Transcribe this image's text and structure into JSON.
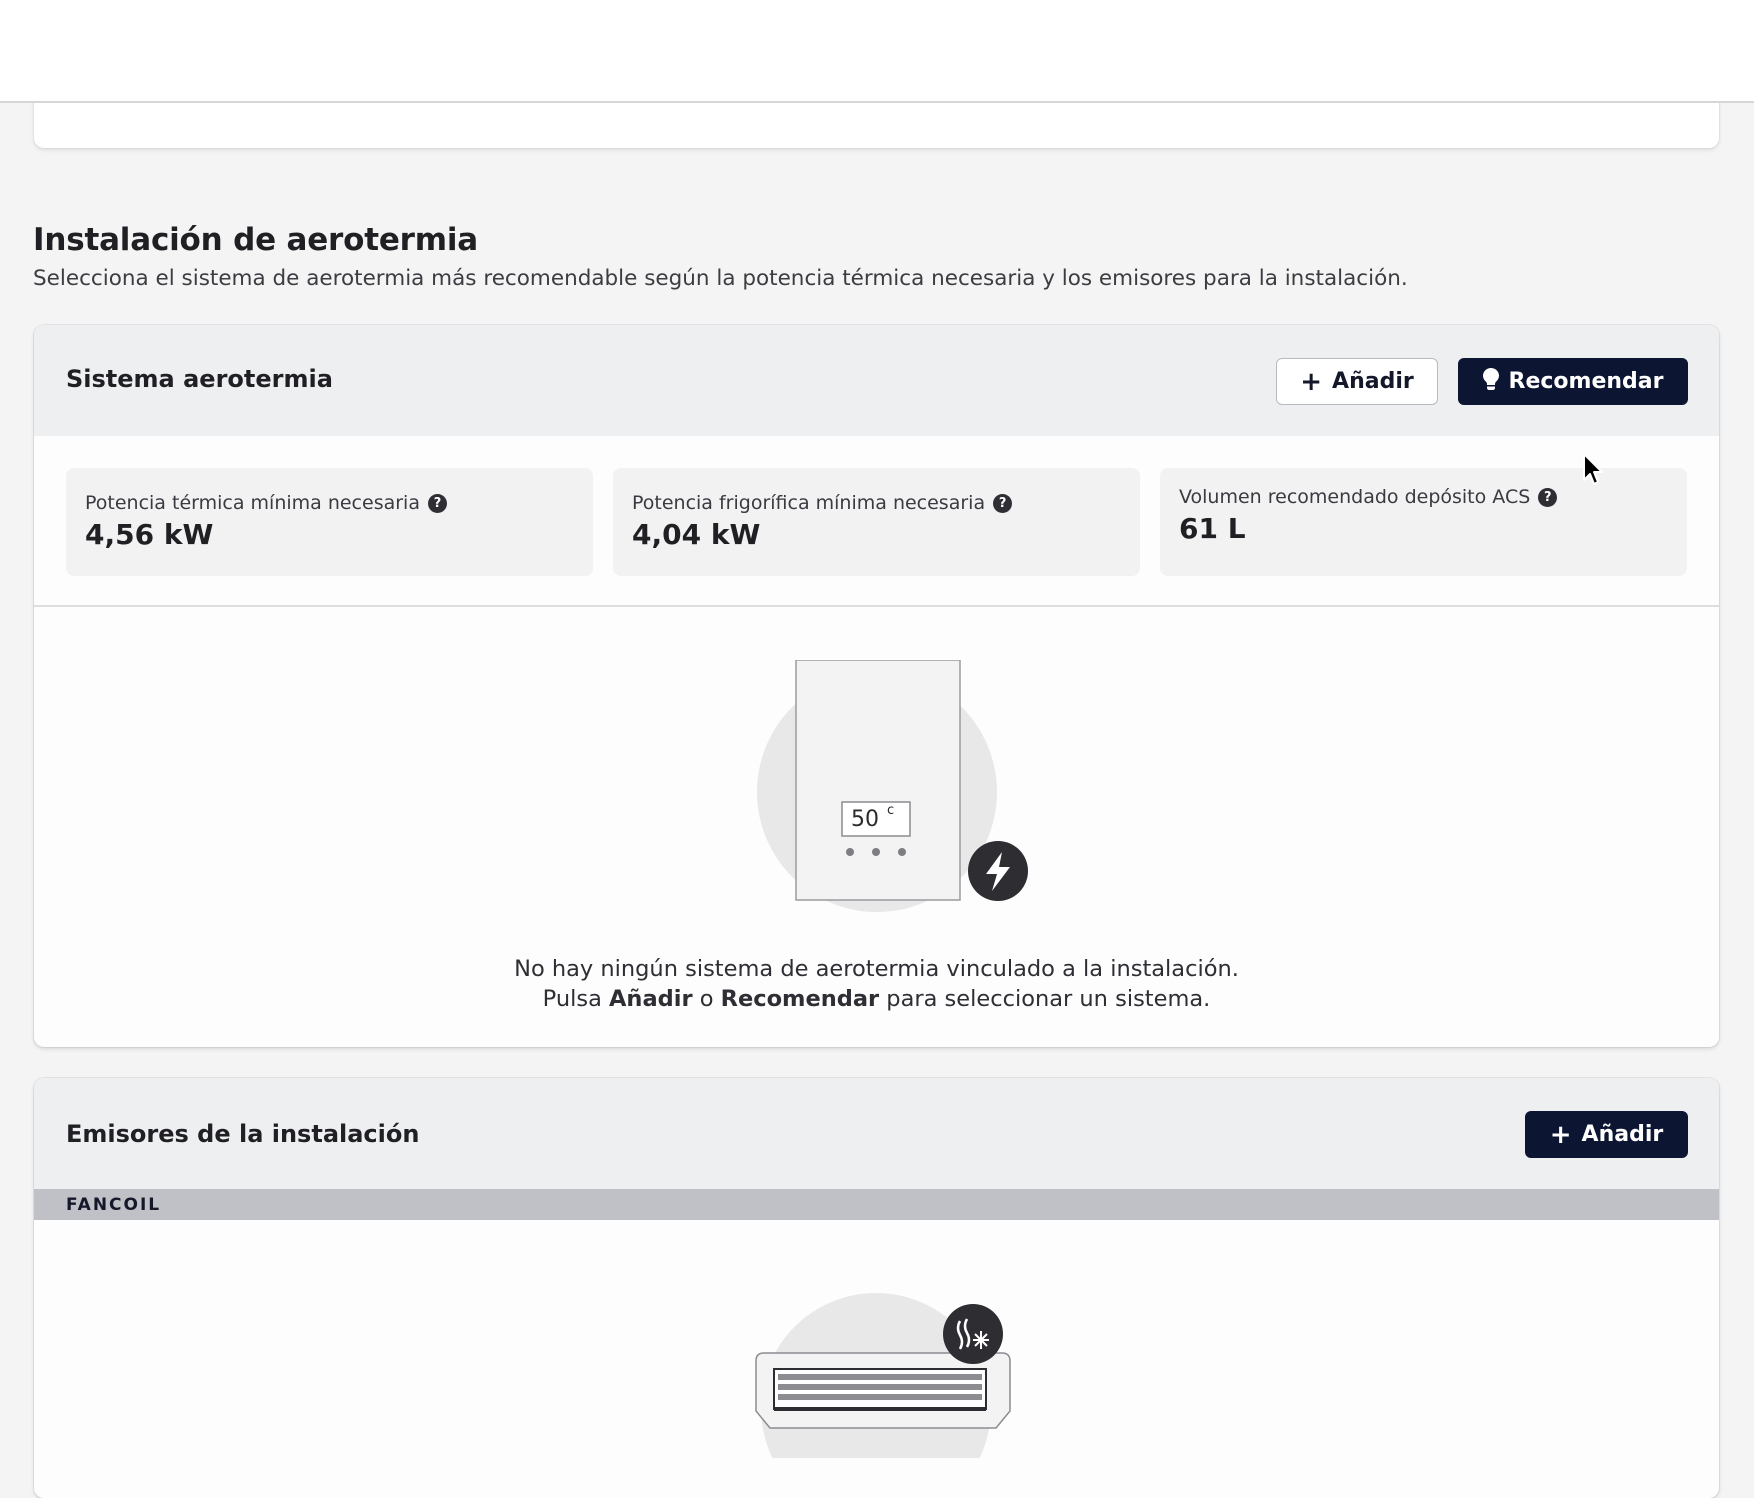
{
  "section": {
    "title": "Instalación de aerotermia",
    "description": "Selecciona el sistema de aerotermia más recomendable según la potencia térmica necesaria y los emisores para la instalación."
  },
  "sistema": {
    "title": "Sistema aerotermia",
    "add_label": "Añadir",
    "recommend_label": "Recomendar",
    "stats": [
      {
        "label": "Potencia térmica mínima necesaria",
        "value": "4,56 kW"
      },
      {
        "label": "Potencia frigorífica mínima necesaria",
        "value": "4,04 kW"
      },
      {
        "label": "Volumen recomendado depósito ACS",
        "value": "61 L"
      }
    ],
    "illustration": {
      "display_temp": "50",
      "display_unit": "c",
      "badge_icon": "lightning-bolt-icon"
    },
    "empty": {
      "line1": "No hay ningún sistema de aerotermia vinculado a la instalación.",
      "prefix": "Pulsa",
      "add": "Añadir",
      "or": "o",
      "recommend": "Recomendar",
      "suffix": "para seleccionar un sistema."
    }
  },
  "emisores": {
    "title": "Emisores de la instalación",
    "add_label": "Añadir",
    "group_label": "FANCOIL",
    "badge_icon": "heat-cool-icon"
  },
  "colors": {
    "primary_dark": "#0c1633",
    "header_bg": "#eeeff1",
    "group_bar": "#c0c1c6"
  }
}
